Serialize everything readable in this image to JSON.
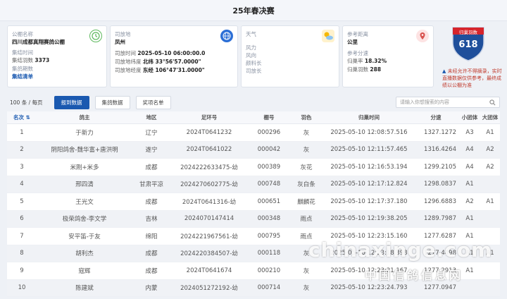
{
  "page": {
    "title": "25年春决赛"
  },
  "info": {
    "club_label": "公棚名称",
    "club_value": "四川成都真翔赛鸽公棚",
    "return_label": "集结时间",
    "count_label": "集结羽数",
    "count_value": "3373",
    "date_label": "集鸽期数",
    "status_value": "集结清单"
  },
  "release": {
    "place_label": "司放地",
    "place_value": "凤州",
    "time_label": "司放时间",
    "time_value": "2025-05-10 06:00:00.0",
    "lat_label": "司放地纬度",
    "lat_value": "北纬 33°56'57.0000\"",
    "lon_label": "司放地经度",
    "lon_value": "东经 106°47'31.0000\""
  },
  "weather": {
    "title": "天气",
    "wind_force": "风力",
    "wind_dir": "风向",
    "temp": "颜料长",
    "range": "司放长"
  },
  "distance": {
    "label": "参考距离",
    "unit": "公里",
    "ref_label": "参考分速",
    "rate_label": "归巢率",
    "rate_value": "18.32%",
    "count_label": "归巢羽数",
    "count_value": "288"
  },
  "badge": {
    "top": "归巢羽数",
    "number": "618"
  },
  "notice": "未经允许不得摘录，实时直播数据仅供参考，最终成绩以公棚为准",
  "toolbar": {
    "per_page": "100 条 / 每页",
    "tab_active": "报到数据",
    "tab_2": "集鸽数据",
    "tab_3": "奖项名单",
    "search_placeholder": "请输入你想搜索的内容"
  },
  "columns": [
    "名次",
    "鸽主",
    "地区",
    "足环号",
    "棚号",
    "羽色",
    "归巢时间",
    "分速",
    "小团体",
    "大团体"
  ],
  "rows": [
    {
      "rank": "1",
      "name": "于新力",
      "area": "辽宁",
      "ring": "2024T0641232",
      "num": "000296",
      "color": "灰",
      "time": "2025-05-10 12:08:57.516",
      "speed": "1327.1272",
      "small": "A3",
      "big": "A1"
    },
    {
      "rank": "2",
      "name": "阴阳鸽舍-魏华富+唐洪明",
      "area": "遂宁",
      "ring": "2024T0641022",
      "num": "000042",
      "color": "灰",
      "time": "2025-05-10 12:11:57.465",
      "speed": "1316.4264",
      "small": "A4",
      "big": "A2"
    },
    {
      "rank": "3",
      "name": "米刚+米多",
      "area": "成都",
      "ring": "2024222633475-幼",
      "num": "000389",
      "color": "灰花",
      "time": "2025-05-10 12:16:53.194",
      "speed": "1299.2105",
      "small": "A4",
      "big": "A2"
    },
    {
      "rank": "4",
      "name": "邢四清",
      "area": "甘肃平凉",
      "ring": "2024270602775-幼",
      "num": "000748",
      "color": "灰白条",
      "time": "2025-05-10 12:17:12.824",
      "speed": "1298.0837",
      "small": "A1",
      "big": ""
    },
    {
      "rank": "5",
      "name": "王光文",
      "area": "成都",
      "ring": "2024T0641316-幼",
      "num": "000651",
      "color": "麒麟花",
      "time": "2025-05-10 12:17:37.180",
      "speed": "1296.6883",
      "small": "A2",
      "big": "A1"
    },
    {
      "rank": "6",
      "name": "极荣鸽舍-李文学",
      "area": "吉林",
      "ring": "2024070147414",
      "num": "000348",
      "color": "雨点",
      "time": "2025-05-10 12:19:38.205",
      "speed": "1289.7987",
      "small": "A1",
      "big": ""
    },
    {
      "rank": "7",
      "name": "安平笛-于友",
      "area": "绵阳",
      "ring": "2024221967561-幼",
      "num": "000795",
      "color": "雨点",
      "time": "2025-05-10 12:23:15.160",
      "speed": "1277.6287",
      "small": "A1",
      "big": ""
    },
    {
      "rank": "8",
      "name": "胡利杰",
      "area": "成都",
      "ring": "2024220384507-幼",
      "num": "000118",
      "color": "灰",
      "time": "2025-05-10 12:23:18.398",
      "speed": "1277.4498",
      "small": "A1",
      "big": "A1"
    },
    {
      "rank": "9",
      "name": "寇辉",
      "area": "成都",
      "ring": "2024T0641674",
      "num": "000210",
      "color": "灰",
      "time": "2025-05-10 12:23:21.167",
      "speed": "1277.2913",
      "small": "A1",
      "big": ""
    },
    {
      "rank": "10",
      "name": "陈建斌",
      "area": "内蒙",
      "ring": "2024051272192-幼",
      "num": "000714",
      "color": "灰",
      "time": "2025-05-10 12:23:24.793",
      "speed": "1277.0947",
      "small": "",
      "big": ""
    }
  ],
  "watermark": {
    "domain": "chinaxinge.com",
    "cn": "中国信鸽信息网"
  },
  "colors": {
    "accent": "#1a59b0",
    "notice": "#c0392b",
    "shield_red": "#d6242b",
    "shield_blue": "#1f4f9b"
  },
  "icons": [
    "clock-icon",
    "globe-icon",
    "weather-icon",
    "location-icon",
    "shield-badge-icon",
    "search-icon",
    "sort-icon"
  ]
}
